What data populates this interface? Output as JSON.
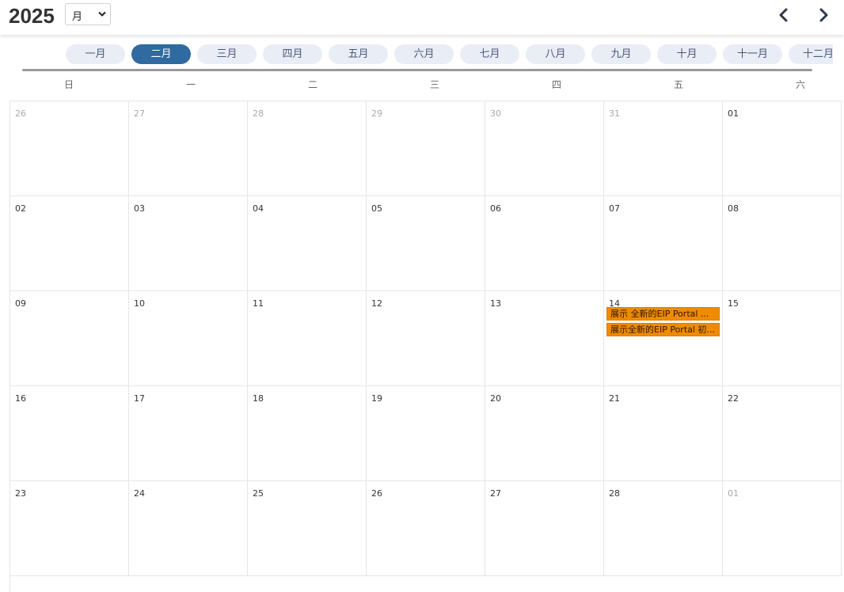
{
  "header": {
    "year": "2025",
    "view_select": {
      "value": "月"
    }
  },
  "months": [
    "一月",
    "二月",
    "三月",
    "四月",
    "五月",
    "六月",
    "七月",
    "八月",
    "九月",
    "十月",
    "十一月",
    "十二月"
  ],
  "active_month_index": 1,
  "weekdays": [
    "日",
    "一",
    "二",
    "三",
    "四",
    "五",
    "六"
  ],
  "weeks": [
    [
      {
        "d": "26",
        "o": true
      },
      {
        "d": "27",
        "o": true
      },
      {
        "d": "28",
        "o": true
      },
      {
        "d": "29",
        "o": true
      },
      {
        "d": "30",
        "o": true
      },
      {
        "d": "31",
        "o": true
      },
      {
        "d": "01",
        "o": false
      }
    ],
    [
      {
        "d": "02",
        "o": false
      },
      {
        "d": "03",
        "o": false
      },
      {
        "d": "04",
        "o": false
      },
      {
        "d": "05",
        "o": false
      },
      {
        "d": "06",
        "o": false
      },
      {
        "d": "07",
        "o": false
      },
      {
        "d": "08",
        "o": false
      }
    ],
    [
      {
        "d": "09",
        "o": false
      },
      {
        "d": "10",
        "o": false
      },
      {
        "d": "11",
        "o": false
      },
      {
        "d": "12",
        "o": false
      },
      {
        "d": "13",
        "o": false
      },
      {
        "d": "14",
        "o": false,
        "events": [
          "展示 全新的EIP Portal ...",
          "展示全新的EIP Portal 初..."
        ]
      },
      {
        "d": "15",
        "o": false
      }
    ],
    [
      {
        "d": "16",
        "o": false
      },
      {
        "d": "17",
        "o": false
      },
      {
        "d": "18",
        "o": false
      },
      {
        "d": "19",
        "o": false
      },
      {
        "d": "20",
        "o": false
      },
      {
        "d": "21",
        "o": false
      },
      {
        "d": "22",
        "o": false
      }
    ],
    [
      {
        "d": "23",
        "o": false
      },
      {
        "d": "24",
        "o": false
      },
      {
        "d": "25",
        "o": false
      },
      {
        "d": "26",
        "o": false
      },
      {
        "d": "27",
        "o": false
      },
      {
        "d": "28",
        "o": false
      },
      {
        "d": "01",
        "o": true
      }
    ]
  ],
  "colors": {
    "active_month": "#2f6aa0",
    "month_pill": "#e9edf6",
    "event": "#f08a00"
  }
}
